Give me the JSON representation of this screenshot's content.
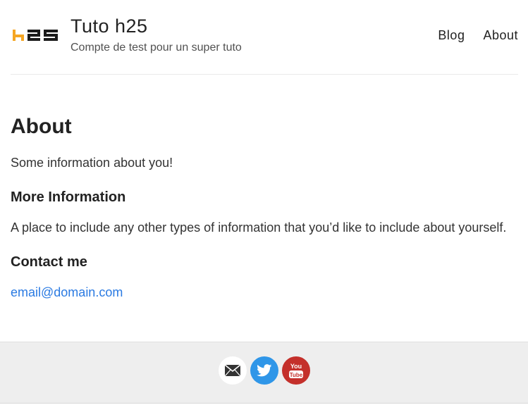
{
  "header": {
    "logo_text": "h25",
    "title": "Tuto h25",
    "description": "Compte de test pour un super tuto",
    "nav": [
      {
        "label": "Blog"
      },
      {
        "label": "About"
      }
    ]
  },
  "main": {
    "heading": "About",
    "intro": "Some information about you!",
    "more_heading": "More Information",
    "more_text": "A place to include any other types of information that you’d like to include about yourself.",
    "contact_heading": "Contact me",
    "email": "email@domain.com"
  },
  "footer": {
    "social": [
      {
        "icon": "mail-icon"
      },
      {
        "icon": "twitter-icon"
      },
      {
        "icon": "youtube-icon",
        "label_top": "You",
        "label_bottom": "Tube"
      }
    ]
  },
  "colors": {
    "link": "#2a7ae2",
    "logo_orange": "#f5a623",
    "twitter": "#2f96e8",
    "youtube": "#c4302b",
    "footer_bg": "#eeeeee"
  }
}
